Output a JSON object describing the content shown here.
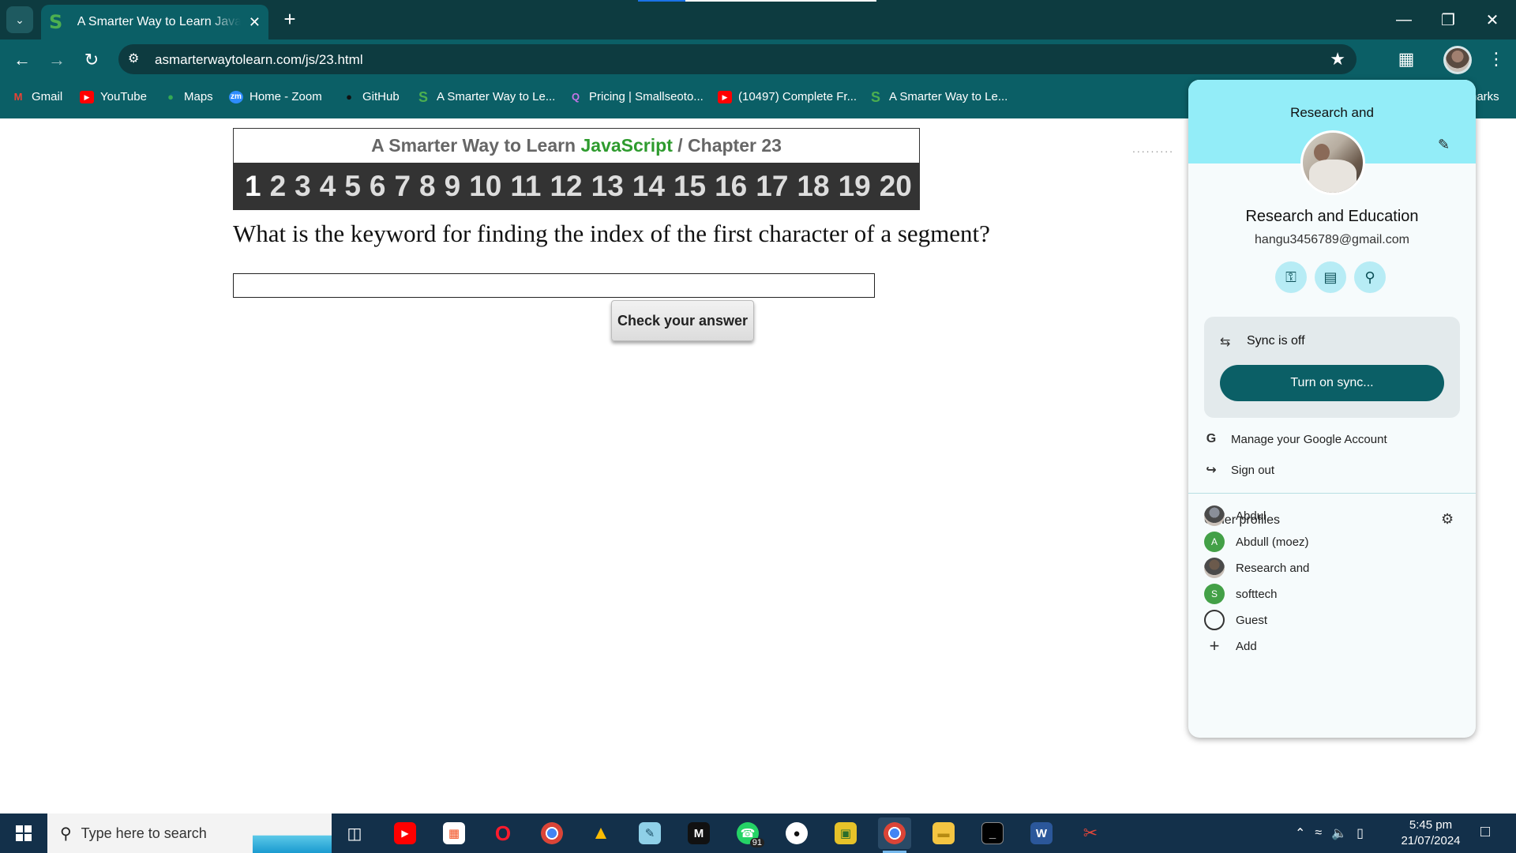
{
  "browser": {
    "tab": {
      "title": "A Smarter Way to Learn JavaScri",
      "favicon": "S"
    },
    "url": "asmarterwaytolearn.com/js/23.html",
    "bookmarks": [
      {
        "label": "Gmail",
        "icon": "gmail-icon",
        "glyph": "M",
        "color": "#ea4335"
      },
      {
        "label": "YouTube",
        "icon": "youtube-icon",
        "glyph": "▶",
        "color": "#ff0000"
      },
      {
        "label": "Maps",
        "icon": "maps-icon",
        "glyph": "●",
        "color": "#34a853"
      },
      {
        "label": "Home - Zoom",
        "icon": "zoom-icon",
        "glyph": "zm",
        "color": "#2d8cff"
      },
      {
        "label": "GitHub",
        "icon": "github-icon",
        "glyph": "●",
        "color": "#111111"
      },
      {
        "label": "A Smarter Way to Le...",
        "icon": "smarter-way-icon",
        "glyph": "S",
        "color": "#4caf50"
      },
      {
        "label": "Pricing | Smallseoto...",
        "icon": "smallseotools-icon",
        "glyph": "Q",
        "color": "#c774e8"
      },
      {
        "label": "(10497) Complete Fr...",
        "icon": "youtube-icon",
        "glyph": "▶",
        "color": "#ff0000"
      },
      {
        "label": "A Smarter Way to Le...",
        "icon": "smarter-way-icon",
        "glyph": "S",
        "color": "#4caf50"
      }
    ],
    "bookmarks_overflow": "harks"
  },
  "page": {
    "header": {
      "prefix": "A Smarter Way to Learn",
      "brand": "JavaScript",
      "separator": "/",
      "chapter": "Chapter 23"
    },
    "chapter_numbers": [
      "1",
      "2",
      "3",
      "4",
      "5",
      "6",
      "7",
      "8",
      "9",
      "10",
      "11",
      "12",
      "13",
      "14",
      "15",
      "16",
      "17",
      "18",
      "19",
      "20"
    ],
    "question": "What is the keyword for finding the index of the first character of a segment?",
    "answer_value": "",
    "check_button": "Check your answer",
    "dots": "........."
  },
  "profile_panel": {
    "heading": "Research and",
    "name": "Research and Education",
    "email": "hangu3456789@gmail.com",
    "sync_status": "Sync is off",
    "sync_button": "Turn on sync...",
    "manage_account": "Manage your Google Account",
    "sign_out": "Sign out",
    "other_profiles_title": "Other profiles",
    "other_profiles": [
      {
        "name": "Abdul",
        "avatar": "photo",
        "color": "#8a8f99",
        "letter": ""
      },
      {
        "name": "Abdull (moez)",
        "avatar": "letter",
        "color": "#43a047",
        "letter": "A"
      },
      {
        "name": "Research and",
        "avatar": "photo",
        "color": "#6b5a4c",
        "letter": ""
      },
      {
        "name": "softtech",
        "avatar": "letter",
        "color": "#43a047",
        "letter": "S"
      },
      {
        "name": "Guest",
        "avatar": "guest-icon",
        "color": "#f6fbfc",
        "letter": ""
      },
      {
        "name": "Add",
        "avatar": "plus-icon",
        "color": "#f6fbfc",
        "letter": ""
      }
    ]
  },
  "taskbar": {
    "search_placeholder": "Type here to search",
    "whatsapp_badge": "91",
    "time": "5:45 pm",
    "date": "21/07/2024"
  }
}
